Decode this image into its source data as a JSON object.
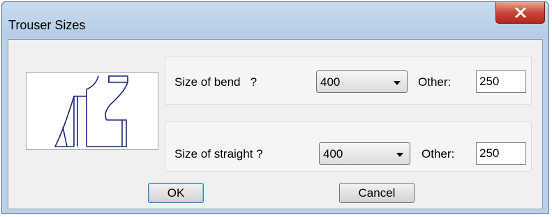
{
  "window": {
    "title": "Trouser Sizes",
    "close_icon": "close-icon"
  },
  "preview": {
    "icon": "trouser-shape-preview"
  },
  "bend": {
    "label": "Size of bend   ?",
    "selected": "400",
    "other_label": "Other:",
    "other_value": "250"
  },
  "straight": {
    "label": "Size of straight ?",
    "selected": "400",
    "other_label": "Other:",
    "other_value": "250"
  },
  "buttons": {
    "ok": "OK",
    "cancel": "Cancel"
  }
}
